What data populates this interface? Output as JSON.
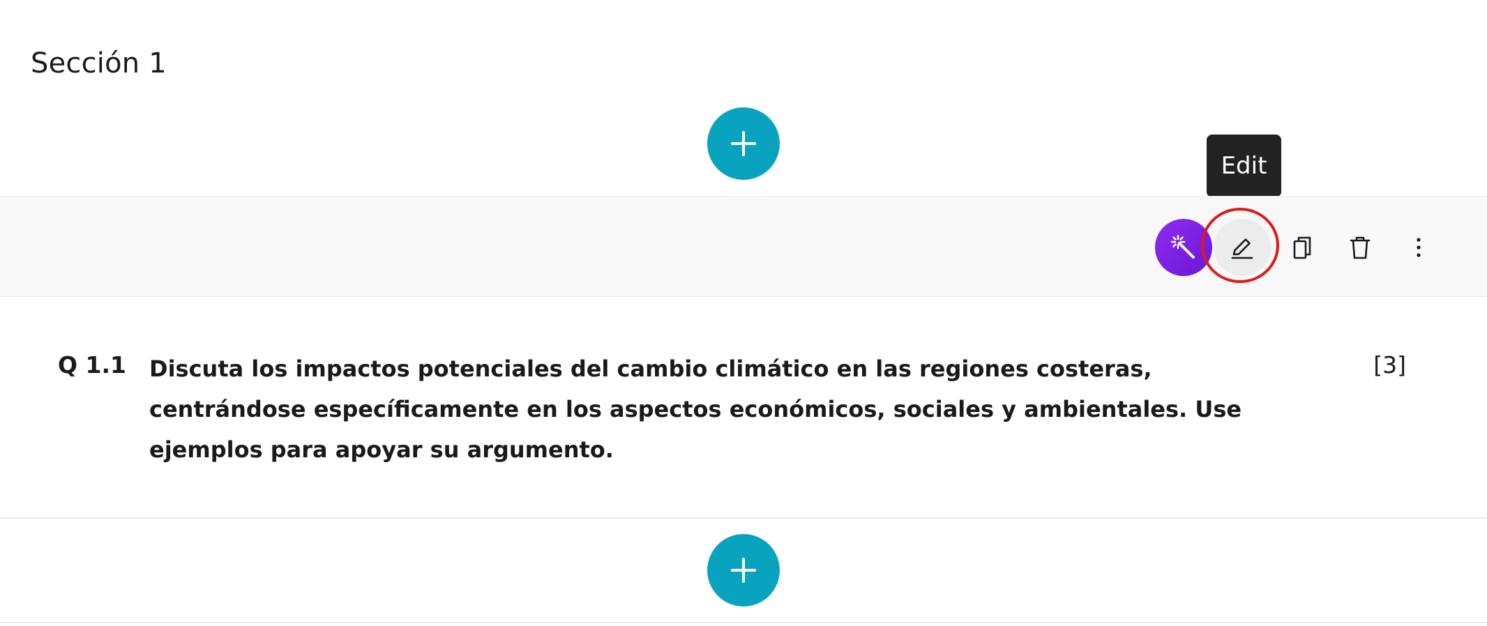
{
  "section": {
    "title": "Sección 1"
  },
  "buttons": {
    "add_question_icon": "plus-icon"
  },
  "toolbar": {
    "magic_icon": "magic-wand-icon",
    "edit_icon": "pencil-icon",
    "copy_icon": "copy-icon",
    "delete_icon": "trash-icon",
    "more_icon": "more-vertical-icon"
  },
  "tooltip": {
    "label": "Edit"
  },
  "question": {
    "number": "Q 1.1",
    "text": "Discuta los impactos potenciales del cambio climático en las regiones costeras, centrándose específicamente en los aspectos económicos, sociales y ambientales. Use ejemplos para apoyar su argumento.",
    "marks": "[3]"
  },
  "colors": {
    "accent_teal": "#0aa3bf",
    "magic_purple": "#7c22e6",
    "highlight_red": "#e01818",
    "tooltip_bg": "#222222"
  }
}
